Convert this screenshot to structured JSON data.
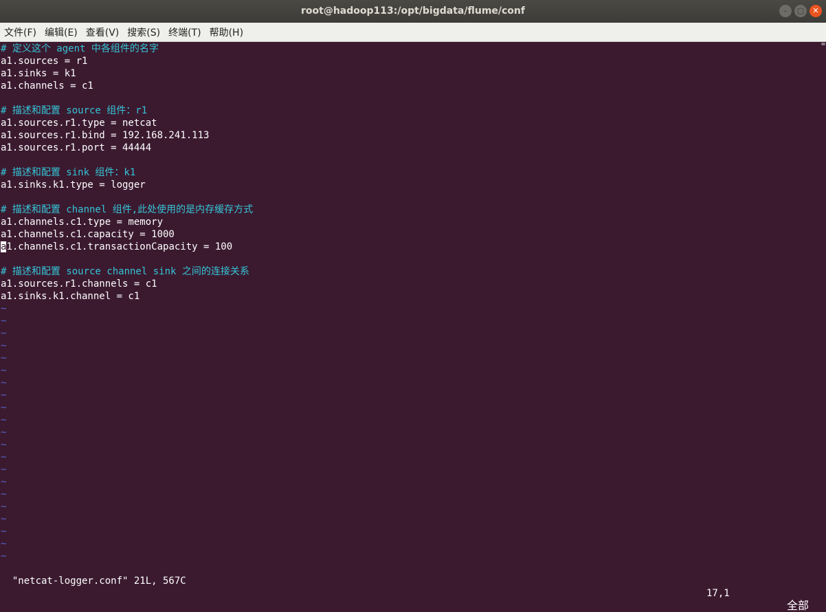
{
  "window": {
    "title": "root@hadoop113:/opt/bigdata/flume/conf",
    "buttons": [
      "–",
      "▢",
      "✕"
    ]
  },
  "menubar": [
    "文件(F)",
    "编辑(E)",
    "查看(V)",
    "搜索(S)",
    "终端(T)",
    "帮助(H)"
  ],
  "editor": {
    "lines": [
      {
        "type": "comment",
        "text": "# 定义这个 agent 中各组件的名字"
      },
      {
        "type": "code",
        "text": "a1.sources = r1"
      },
      {
        "type": "code",
        "text": "a1.sinks = k1"
      },
      {
        "type": "code",
        "text": "a1.channels = c1"
      },
      {
        "type": "blank",
        "text": ""
      },
      {
        "type": "comment",
        "text": "# 描述和配置 source 组件：r1"
      },
      {
        "type": "code",
        "text": "a1.sources.r1.type = netcat"
      },
      {
        "type": "code",
        "text": "a1.sources.r1.bind = 192.168.241.113"
      },
      {
        "type": "code",
        "text": "a1.sources.r1.port = 44444"
      },
      {
        "type": "blank",
        "text": ""
      },
      {
        "type": "comment",
        "text": "# 描述和配置 sink 组件：k1"
      },
      {
        "type": "code",
        "text": "a1.sinks.k1.type = logger"
      },
      {
        "type": "blank",
        "text": ""
      },
      {
        "type": "comment",
        "text": "# 描述和配置 channel 组件,此处使用的是内存缓存方式"
      },
      {
        "type": "code",
        "text": "a1.channels.c1.type = memory"
      },
      {
        "type": "code",
        "text": "a1.channels.c1.capacity = 1000"
      },
      {
        "type": "cursor",
        "cursor_char": "a",
        "text": "1.channels.c1.transactionCapacity = 100"
      },
      {
        "type": "blank",
        "text": ""
      },
      {
        "type": "comment",
        "text": "# 描述和配置 source channel sink 之间的连接关系"
      },
      {
        "type": "code",
        "text": "a1.sources.r1.channels = c1"
      },
      {
        "type": "code",
        "text": "a1.sinks.k1.channel = c1"
      },
      {
        "type": "tilde",
        "text": "~"
      },
      {
        "type": "tilde",
        "text": "~"
      },
      {
        "type": "tilde",
        "text": "~"
      },
      {
        "type": "tilde",
        "text": "~"
      },
      {
        "type": "tilde",
        "text": "~"
      },
      {
        "type": "tilde",
        "text": "~"
      },
      {
        "type": "tilde",
        "text": "~"
      },
      {
        "type": "tilde",
        "text": "~"
      },
      {
        "type": "tilde",
        "text": "~"
      },
      {
        "type": "tilde",
        "text": "~"
      },
      {
        "type": "tilde",
        "text": "~"
      },
      {
        "type": "tilde",
        "text": "~"
      },
      {
        "type": "tilde",
        "text": "~"
      },
      {
        "type": "tilde",
        "text": "~"
      },
      {
        "type": "tilde",
        "text": "~"
      },
      {
        "type": "tilde",
        "text": "~"
      },
      {
        "type": "tilde",
        "text": "~"
      },
      {
        "type": "tilde",
        "text": "~"
      },
      {
        "type": "tilde",
        "text": "~"
      },
      {
        "type": "tilde",
        "text": "~"
      },
      {
        "type": "tilde",
        "text": "~"
      }
    ]
  },
  "status": {
    "file_info": "\"netcat-logger.conf\" 21L, 567C",
    "position": "17,1",
    "scroll": "全部"
  }
}
